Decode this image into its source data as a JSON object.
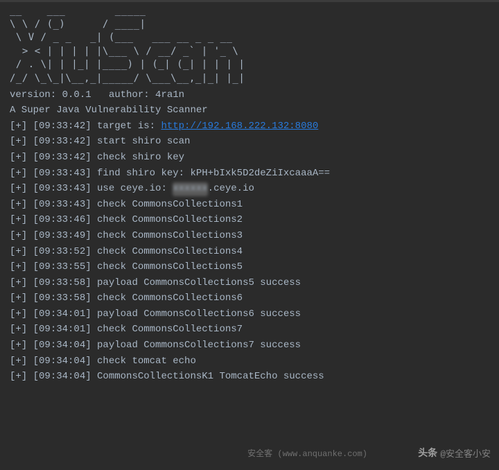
{
  "ascii": {
    "l1": "__    ___        _____",
    "l2": "\\ \\ / (_)      / ____|",
    "l3": " \\ V / _ _   _| (___   ___ __ _ _ __",
    "l4": "  > < | | | | |\\___ \\ / __/ _` | '_ \\",
    "l5": " / . \\| | |_| |____) | (_| (_| | | | |",
    "l6": "/_/ \\_\\_|\\__,_|_____/ \\___\\__,_|_| |_|"
  },
  "info": {
    "version_line": "version: 0.0.1   author: 4ra1n",
    "subtitle": "A Super Java Vulnerability Scanner"
  },
  "prefix": "[+]",
  "entries": [
    {
      "ts": "09:33:42",
      "msg_pre": "target is: ",
      "link": "http://192.168.222.132:8080"
    },
    {
      "ts": "09:33:42",
      "msg": "start shiro scan"
    },
    {
      "ts": "09:33:42",
      "msg": "check shiro key"
    },
    {
      "ts": "09:33:43",
      "msg": "find shiro key: kPH+bIxk5D2deZiIxcaaaA=="
    },
    {
      "ts": "09:33:43",
      "msg_pre": "use ceye.io: ",
      "blur": "xxxxxx",
      "msg_post": ".ceye.io"
    },
    {
      "ts": "09:33:43",
      "msg": "check CommonsCollections1"
    },
    {
      "ts": "09:33:46",
      "msg": "check CommonsCollections2"
    },
    {
      "ts": "09:33:49",
      "msg": "check CommonsCollections3"
    },
    {
      "ts": "09:33:52",
      "msg": "check CommonsCollections4"
    },
    {
      "ts": "09:33:55",
      "msg": "check CommonsCollections5"
    },
    {
      "ts": "09:33:58",
      "msg": "payload CommonsCollections5 success"
    },
    {
      "ts": "09:33:58",
      "msg": "check CommonsCollections6"
    },
    {
      "ts": "09:34:01",
      "msg": "payload CommonsCollections6 success"
    },
    {
      "ts": "09:34:01",
      "msg": "check CommonsCollections7"
    },
    {
      "ts": "09:34:04",
      "msg": "payload CommonsCollections7 success"
    },
    {
      "ts": "09:34:04",
      "msg": "check tomcat echo"
    },
    {
      "ts": "09:34:04",
      "msg": "CommonsCollectionsK1 TomcatEcho success"
    }
  ],
  "watermark": {
    "source": "安全客 (www.anquanke.com)",
    "toutiao_prefix": "头条",
    "toutiao_user": "@安全客小安"
  }
}
